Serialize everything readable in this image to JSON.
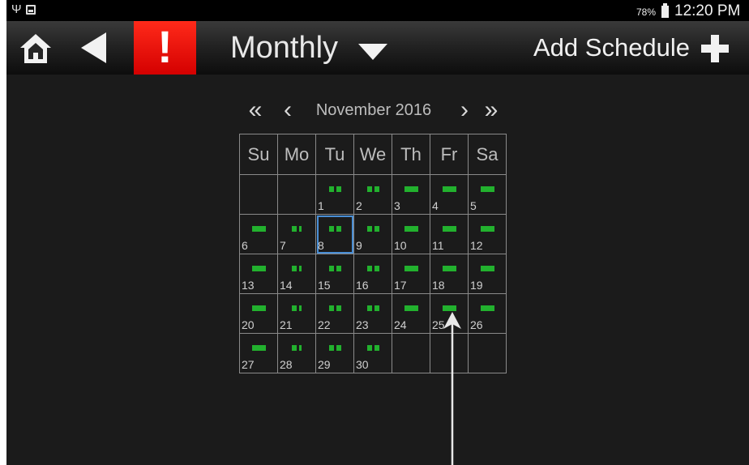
{
  "status_bar": {
    "battery_percent": "78%",
    "time": "12:20 PM",
    "icons": [
      "usb-icon",
      "screenshot-icon",
      "battery-icon"
    ]
  },
  "toolbar": {
    "view_mode": "Monthly",
    "add_schedule_label": "Add Schedule",
    "alert_symbol": "!",
    "icons": [
      "home-icon",
      "back-arrow-icon",
      "alert-icon",
      "dropdown-triangle-icon",
      "plus-icon"
    ],
    "colors": {
      "alert_bg": "#e00000",
      "toolbar_bg": "#202020"
    }
  },
  "calendar": {
    "month_label": "November 2016",
    "nav": {
      "prev_year": "«",
      "prev_month": "‹",
      "next_month": "›",
      "next_year": "»"
    },
    "weekdays": [
      "Su",
      "Mo",
      "Tu",
      "We",
      "Th",
      "Fr",
      "Sa"
    ],
    "selected_day": 8,
    "schedule_color": "#22b12e",
    "weeks": [
      [
        null,
        null,
        {
          "day": "1",
          "marks": "pair"
        },
        {
          "day": "2",
          "marks": "pair"
        },
        {
          "day": "3",
          "marks": "bar"
        },
        {
          "day": "4",
          "marks": "bar"
        },
        {
          "day": "5",
          "marks": "bar"
        }
      ],
      [
        {
          "day": "6",
          "marks": "bar"
        },
        {
          "day": "7",
          "marks": "dot-line"
        },
        {
          "day": "8",
          "marks": "pair"
        },
        {
          "day": "9",
          "marks": "pair"
        },
        {
          "day": "10",
          "marks": "bar"
        },
        {
          "day": "11",
          "marks": "bar"
        },
        {
          "day": "12",
          "marks": "bar"
        }
      ],
      [
        {
          "day": "13",
          "marks": "bar"
        },
        {
          "day": "14",
          "marks": "dot-line"
        },
        {
          "day": "15",
          "marks": "pair"
        },
        {
          "day": "16",
          "marks": "pair"
        },
        {
          "day": "17",
          "marks": "bar"
        },
        {
          "day": "18",
          "marks": "bar"
        },
        {
          "day": "19",
          "marks": "bar"
        }
      ],
      [
        {
          "day": "20",
          "marks": "bar"
        },
        {
          "day": "21",
          "marks": "dot-line"
        },
        {
          "day": "22",
          "marks": "pair"
        },
        {
          "day": "23",
          "marks": "pair"
        },
        {
          "day": "24",
          "marks": "bar"
        },
        {
          "day": "25",
          "marks": "bar"
        },
        {
          "day": "26",
          "marks": "bar"
        }
      ],
      [
        {
          "day": "27",
          "marks": "bar"
        },
        {
          "day": "28",
          "marks": "dot-line"
        },
        {
          "day": "29",
          "marks": "pair"
        },
        {
          "day": "30",
          "marks": "pair"
        },
        null,
        null,
        null
      ]
    ]
  },
  "annotation": {
    "arrow_target_day": "25"
  }
}
